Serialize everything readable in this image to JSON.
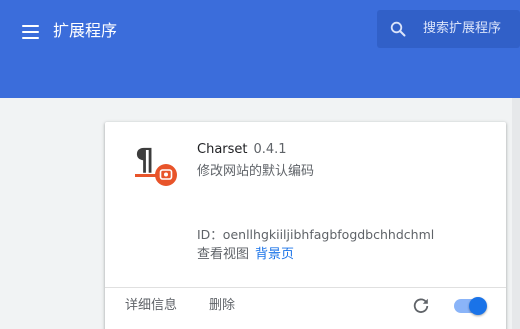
{
  "header": {
    "title": "扩展程序",
    "menu_icon": "hamburger-menu-icon",
    "search": {
      "placeholder": "搜索扩展程序",
      "icon": "search-icon"
    }
  },
  "extension": {
    "name": "Charset",
    "version": "0.4.1",
    "description": "修改网站的默认编码",
    "id_line": "ID：oenllhgkiiljibhfagbfogdbchhdchml",
    "inspect_label": "查看视图",
    "inspect_link": "背景页",
    "details_label": "详细信息",
    "remove_label": "删除",
    "reload_icon": "reload-icon",
    "enabled": true
  },
  "colors": {
    "header_bg": "#3b6ddb",
    "search_bg": "#3160c8",
    "link": "#1a73e8",
    "toggle_knob": "#1a73e8",
    "toggle_track": "#8ab4f8",
    "icon_accent": "#e8542a"
  }
}
